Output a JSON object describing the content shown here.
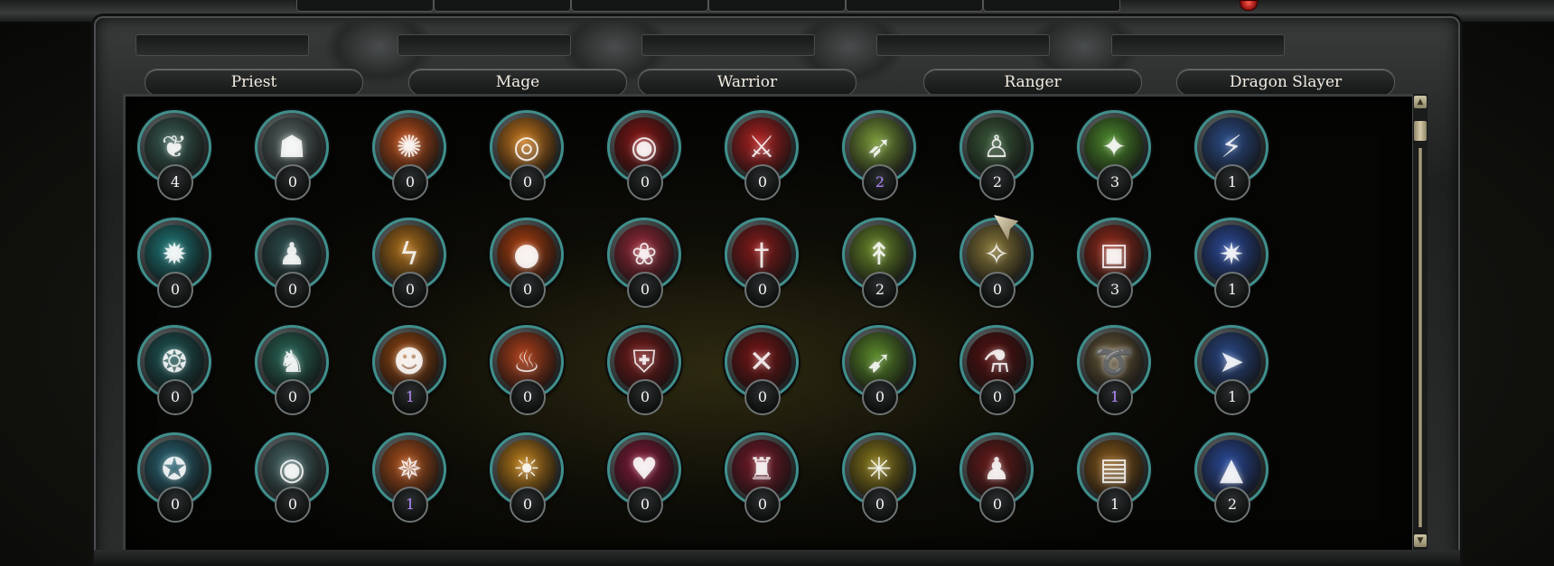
{
  "tabs": [
    "Priest",
    "Mage",
    "Warrior",
    "Ranger",
    "Dragon Slayer"
  ],
  "colors": {
    "purple_count": "#b58cff",
    "normal_count": "#f4f4f4",
    "ring": "#3f8f8c"
  },
  "skills": [
    [
      {
        "icon": "worm-creature-icon",
        "count": "4",
        "bg": "#3a5f55",
        "glyph": "❦"
      },
      {
        "icon": "ghost-portal-icon",
        "count": "0",
        "bg": "#5a6a68",
        "glyph": "☗"
      },
      {
        "icon": "fire-burst-icon",
        "count": "0",
        "bg": "#c0501a",
        "glyph": "✺"
      },
      {
        "icon": "fire-spiral-icon",
        "count": "0",
        "bg": "#c8781c",
        "glyph": "◎"
      },
      {
        "icon": "blood-swirl-icon",
        "count": "0",
        "bg": "#8a1515",
        "glyph": "◉"
      },
      {
        "icon": "red-warrior-icon",
        "count": "0",
        "bg": "#b02020",
        "glyph": "⚔"
      },
      {
        "icon": "bow-icon",
        "count": "2",
        "bg": "#7a9a3a",
        "glyph": "➶",
        "purple": true
      },
      {
        "icon": "ranger-figure-icon",
        "count": "2",
        "bg": "#3a5a3a",
        "glyph": "♙"
      },
      {
        "icon": "green-vortex-icon",
        "count": "3",
        "bg": "#4c8a2c",
        "glyph": "✦"
      },
      {
        "icon": "blue-strike-icon",
        "count": "1",
        "bg": "#2c4e8a",
        "glyph": "⚡"
      }
    ],
    [
      {
        "icon": "cyan-claw-icon",
        "count": "0",
        "bg": "#1f7a7a",
        "glyph": "✹"
      },
      {
        "icon": "dark-figure-icon",
        "count": "0",
        "bg": "#2e4f4f",
        "glyph": "♟"
      },
      {
        "icon": "lightning-fire-icon",
        "count": "0",
        "bg": "#b0701a",
        "glyph": "ϟ"
      },
      {
        "icon": "fire-ball-icon",
        "count": "0",
        "bg": "#b04010",
        "glyph": "●"
      },
      {
        "icon": "red-dancer-icon",
        "count": "0",
        "bg": "#9a2a3a",
        "glyph": "❀"
      },
      {
        "icon": "red-blade-icon",
        "count": "0",
        "bg": "#8a1a1a",
        "glyph": "†"
      },
      {
        "icon": "green-arrows-icon",
        "count": "2",
        "bg": "#6a8a2a",
        "glyph": "↟"
      },
      {
        "icon": "golden-trap-icon",
        "count": "0",
        "bg": "#8a7a3a",
        "glyph": "✧"
      },
      {
        "icon": "spell-book-icon",
        "count": "3",
        "bg": "#9a2a1a",
        "glyph": "▣"
      },
      {
        "icon": "blue-burst-icon",
        "count": "1",
        "bg": "#2a4a9a",
        "glyph": "✷"
      }
    ],
    [
      {
        "icon": "rune-circle-icon",
        "count": "0",
        "bg": "#1f5a5a",
        "glyph": "❂"
      },
      {
        "icon": "green-specter-icon",
        "count": "0",
        "bg": "#2a6a5a",
        "glyph": "♞"
      },
      {
        "icon": "fire-skull-icon",
        "count": "1",
        "bg": "#a04a10",
        "glyph": "☻",
        "purple": true
      },
      {
        "icon": "burning-figure-icon",
        "count": "0",
        "bg": "#b0401a",
        "glyph": "♨"
      },
      {
        "icon": "red-shield-icon",
        "count": "0",
        "bg": "#7a1a1a",
        "glyph": "⛨"
      },
      {
        "icon": "red-cross-icon",
        "count": "0",
        "bg": "#7a1515",
        "glyph": "✕"
      },
      {
        "icon": "green-volley-icon",
        "count": "0",
        "bg": "#5a8a2a",
        "glyph": "➹"
      },
      {
        "icon": "red-potion-icon",
        "count": "0",
        "bg": "#5a1010",
        "glyph": "⚗"
      },
      {
        "icon": "golden-hook-icon",
        "count": "1",
        "bg": "#6a5a3a",
        "glyph": "➰",
        "purple": true
      },
      {
        "icon": "blue-dash-icon",
        "count": "1",
        "bg": "#2a4a8a",
        "glyph": "➤"
      }
    ],
    [
      {
        "icon": "cyan-whirl-icon",
        "count": "0",
        "bg": "#2a6a7a",
        "glyph": "✪"
      },
      {
        "icon": "eye-icon",
        "count": "0",
        "bg": "#4a6a6a",
        "glyph": "◉"
      },
      {
        "icon": "orange-sparks-icon",
        "count": "1",
        "bg": "#b0501a",
        "glyph": "✵",
        "purple": true
      },
      {
        "icon": "sun-flare-icon",
        "count": "0",
        "bg": "#c0801a",
        "glyph": "☀"
      },
      {
        "icon": "pink-heart-icon",
        "count": "0",
        "bg": "#8a1a3a",
        "glyph": "♥"
      },
      {
        "icon": "hooded-fighter-icon",
        "count": "0",
        "bg": "#7a1a2a",
        "glyph": "♜"
      },
      {
        "icon": "golden-net-icon",
        "count": "0",
        "bg": "#8a7a1a",
        "glyph": "✳"
      },
      {
        "icon": "twin-figures-icon",
        "count": "0",
        "bg": "#6a1a1a",
        "glyph": "♟"
      },
      {
        "icon": "wooden-crate-icon",
        "count": "1",
        "bg": "#8a5a1a",
        "glyph": "▤"
      },
      {
        "icon": "blue-spike-icon",
        "count": "2",
        "bg": "#2a4a9a",
        "glyph": "▲"
      }
    ]
  ]
}
